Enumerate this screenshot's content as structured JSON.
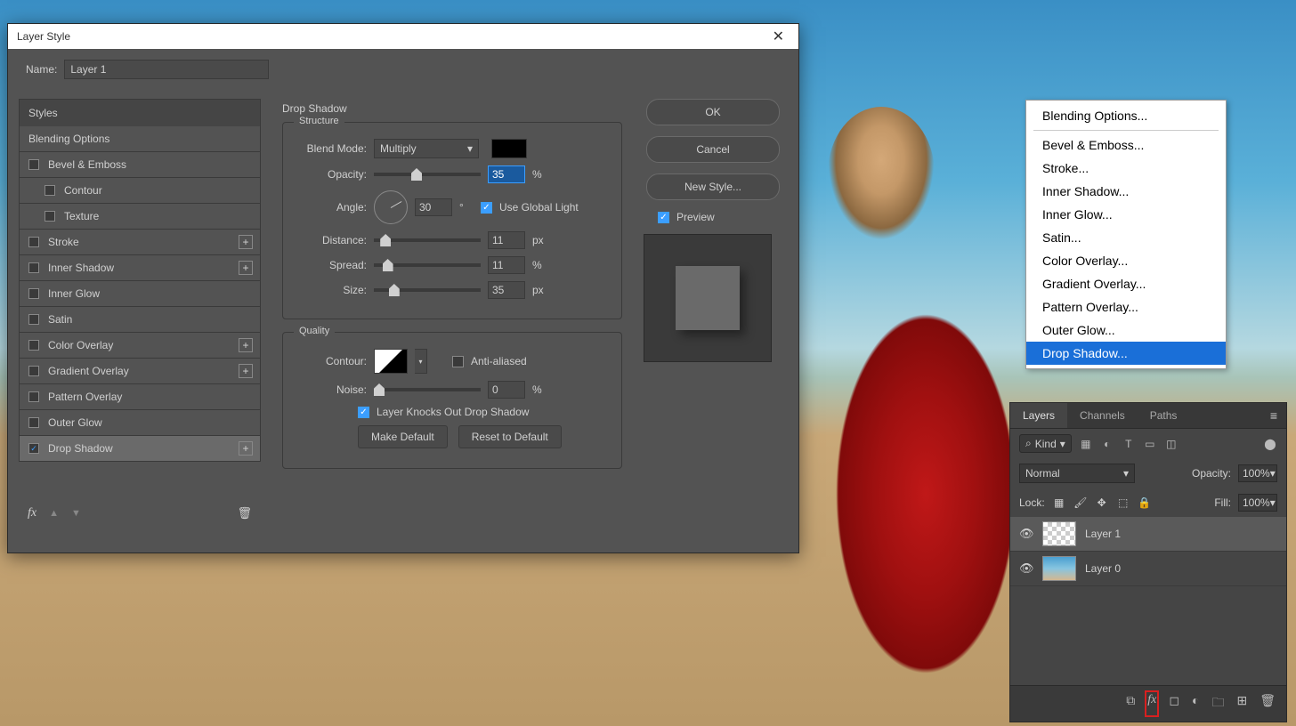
{
  "dialog": {
    "title": "Layer Style",
    "name_label": "Name:",
    "name_value": "Layer 1",
    "styles_header": "Styles",
    "blending_options": "Blending Options",
    "effects": {
      "bevel_emboss": "Bevel & Emboss",
      "contour": "Contour",
      "texture": "Texture",
      "stroke": "Stroke",
      "inner_shadow": "Inner Shadow",
      "inner_glow": "Inner Glow",
      "satin": "Satin",
      "color_overlay": "Color Overlay",
      "gradient_overlay": "Gradient Overlay",
      "pattern_overlay": "Pattern Overlay",
      "outer_glow": "Outer Glow",
      "drop_shadow": "Drop Shadow"
    },
    "section_title": "Drop Shadow",
    "structure_label": "Structure",
    "blend_mode_label": "Blend Mode:",
    "blend_mode_value": "Multiply",
    "opacity_label": "Opacity:",
    "opacity_value": "35",
    "angle_label": "Angle:",
    "angle_value": "30",
    "angle_unit": "°",
    "use_global": "Use Global Light",
    "distance_label": "Distance:",
    "distance_value": "11",
    "spread_label": "Spread:",
    "spread_value": "11",
    "size_label": "Size:",
    "size_value": "35",
    "px": "px",
    "pct": "%",
    "quality_label": "Quality",
    "contour_label": "Contour:",
    "anti_aliased": "Anti-aliased",
    "noise_label": "Noise:",
    "noise_value": "0",
    "knocks_out": "Layer Knocks Out Drop Shadow",
    "make_default": "Make Default",
    "reset_default": "Reset to Default",
    "ok": "OK",
    "cancel": "Cancel",
    "new_style": "New Style...",
    "preview": "Preview"
  },
  "ctx": {
    "blending": "Blending Options...",
    "bevel": "Bevel & Emboss...",
    "stroke": "Stroke...",
    "inner_shadow": "Inner Shadow...",
    "inner_glow": "Inner Glow...",
    "satin": "Satin...",
    "color_overlay": "Color Overlay...",
    "gradient_overlay": "Gradient Overlay...",
    "pattern_overlay": "Pattern Overlay...",
    "outer_glow": "Outer Glow...",
    "drop_shadow": "Drop Shadow..."
  },
  "layers": {
    "tab_layers": "Layers",
    "tab_channels": "Channels",
    "tab_paths": "Paths",
    "kind": "Kind",
    "blend_mode": "Normal",
    "opacity_label": "Opacity:",
    "opacity_value": "100%",
    "lock_label": "Lock:",
    "fill_label": "Fill:",
    "fill_value": "100%",
    "layer1": "Layer 1",
    "layer0": "Layer 0"
  }
}
